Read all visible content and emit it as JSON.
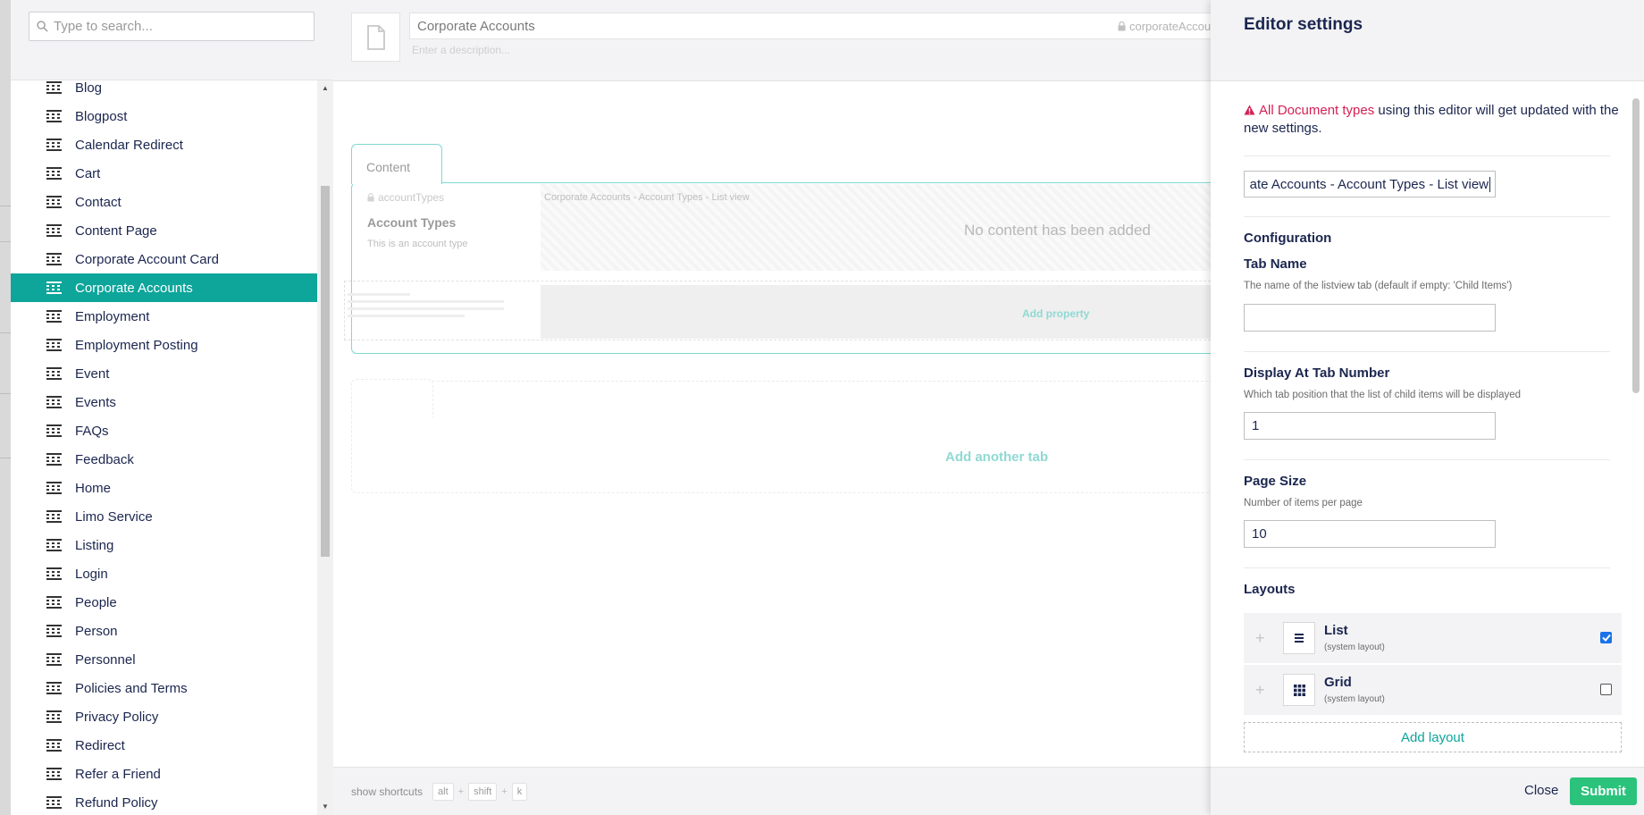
{
  "tree": {
    "search_placeholder": "Type to search...",
    "items": [
      {
        "label": "Blog"
      },
      {
        "label": "Blogpost"
      },
      {
        "label": "Calendar Redirect"
      },
      {
        "label": "Cart"
      },
      {
        "label": "Contact"
      },
      {
        "label": "Content Page"
      },
      {
        "label": "Corporate Account Card"
      },
      {
        "label": "Corporate Accounts",
        "active": true
      },
      {
        "label": "Employment"
      },
      {
        "label": "Employment Posting"
      },
      {
        "label": "Event"
      },
      {
        "label": "Events"
      },
      {
        "label": "FAQs"
      },
      {
        "label": "Feedback"
      },
      {
        "label": "Home"
      },
      {
        "label": "Limo Service"
      },
      {
        "label": "Listing"
      },
      {
        "label": "Login"
      },
      {
        "label": "People"
      },
      {
        "label": "Person"
      },
      {
        "label": "Personnel"
      },
      {
        "label": "Policies and Terms"
      },
      {
        "label": "Privacy Policy"
      },
      {
        "label": "Redirect"
      },
      {
        "label": "Refer a Friend"
      },
      {
        "label": "Refund Policy"
      }
    ]
  },
  "editor": {
    "name": "Corporate Accounts",
    "alias": "corporateAccou",
    "description_placeholder": "Enter a description...",
    "tab_label": "Content",
    "property": {
      "alias": "accountTypes",
      "label": "Account Types",
      "description": "This is an account type",
      "editor_name": "Corporate Accounts - Account Types - List view",
      "empty_text": "No content has been added"
    },
    "add_property": "Add property",
    "add_tab": "Add another tab",
    "footer": {
      "shortcuts_label": "show shortcuts",
      "keys": [
        "alt",
        "shift",
        "k"
      ]
    }
  },
  "dialog": {
    "title": "Editor settings",
    "warning_strong": "All Document types",
    "warning_rest": " using this editor will get updated with the new settings.",
    "editor_name_value": "ate Accounts - Account Types - List view",
    "configuration_title": "Configuration",
    "tab_name": {
      "title": "Tab Name",
      "description": "The name of the listview tab (default if empty: 'Child Items')",
      "value": ""
    },
    "display_at_tab": {
      "title": "Display At Tab Number",
      "description": "Which tab position that the list of child items will be displayed",
      "value": "1"
    },
    "page_size": {
      "title": "Page Size",
      "description": "Number of items per page",
      "value": "10"
    },
    "layouts_title": "Layouts",
    "layouts": [
      {
        "name": "List",
        "sub": "(system layout)",
        "icon": "list-icon",
        "checked": true
      },
      {
        "name": "Grid",
        "sub": "(system layout)",
        "icon": "grid-icon",
        "checked": false
      }
    ],
    "add_layout": "Add layout",
    "close_label": "Close",
    "submit_label": "Submit"
  },
  "colors": {
    "accent": "#0ea59a",
    "warning": "#d42054",
    "submit": "#2bc37c"
  }
}
